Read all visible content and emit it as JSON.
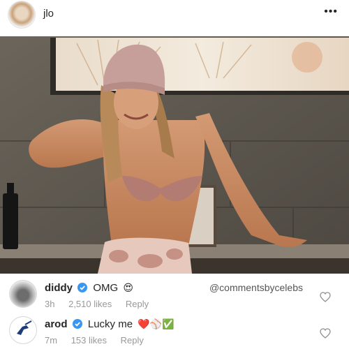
{
  "post": {
    "username": "jlo",
    "more": "•••"
  },
  "watermark": "@commentsbycelebs",
  "comments": [
    {
      "username": "diddy",
      "text": "OMG",
      "emoji": "😍",
      "time": "3h",
      "likes": "2,510 likes",
      "reply": "Reply"
    },
    {
      "username": "arod",
      "text": "Lucky me",
      "emoji": "❤️⚾✅",
      "time": "7m",
      "likes": "153 likes",
      "reply": "Reply"
    }
  ],
  "icons": {
    "verified": "verified-badge-icon",
    "heart": "heart-outline-icon",
    "more": "more-options-icon"
  },
  "colors": {
    "verified": "#3897f0",
    "meta_text": "#999999",
    "primary_text": "#262626"
  }
}
